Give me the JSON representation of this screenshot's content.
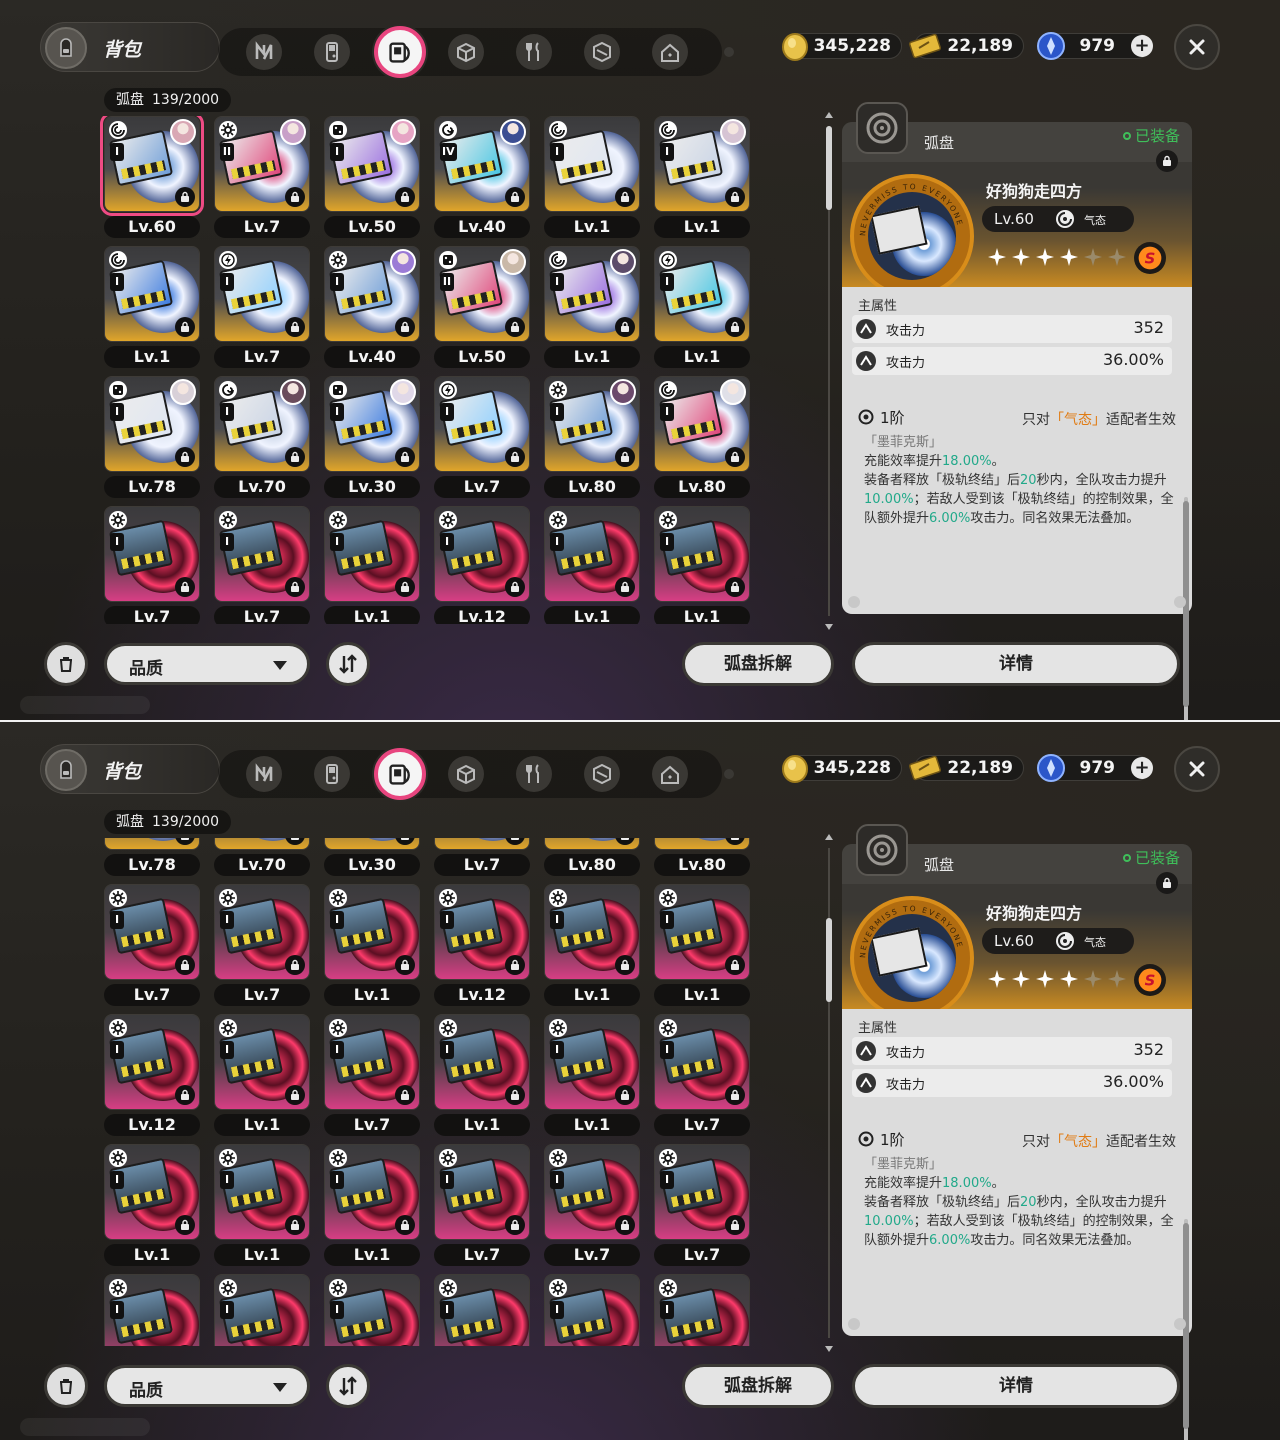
{
  "header": {
    "bag_title": "背包",
    "tabs": [
      "hollow-zero-icon",
      "console-icon",
      "w-engine-disc-icon",
      "box-icon",
      "food-icon",
      "bangboo-icon",
      "home-icon"
    ],
    "active_tab": 2,
    "currencies": [
      {
        "name": "dennies",
        "value": "345,228"
      },
      {
        "name": "film",
        "value": "22,189"
      },
      {
        "name": "polychrome",
        "value": "979"
      }
    ]
  },
  "inventory": {
    "category": "弧盘",
    "count": "139/2000"
  },
  "screens": [
    {
      "items": [
        {
          "lv": "Lv.60",
          "rank": "I",
          "attr": "swirl",
          "tint": "gold",
          "avatar": "#d9a7b4",
          "selected": true
        },
        {
          "lv": "Lv.7",
          "rank": "II",
          "attr": "gear",
          "tint": "gold",
          "avatar": "#c8a0c8"
        },
        {
          "lv": "Lv.50",
          "rank": "I",
          "attr": "dice",
          "tint": "gold",
          "avatar": "#e6a4c4"
        },
        {
          "lv": "Lv.40",
          "rank": "IV",
          "attr": "spiral",
          "tint": "gold",
          "avatar": "#3c4e92"
        },
        {
          "lv": "Lv.1",
          "rank": "I",
          "attr": "swirl",
          "tint": "gold",
          "avatar": ""
        },
        {
          "lv": "Lv.1",
          "rank": "I",
          "attr": "swirl",
          "tint": "gold",
          "avatar": "#d6c4d4"
        },
        {
          "lv": "Lv.1",
          "rank": "I",
          "attr": "swirl",
          "tint": "gold",
          "avatar": ""
        },
        {
          "lv": "Lv.7",
          "rank": "I",
          "attr": "bolt",
          "tint": "gold",
          "avatar": ""
        },
        {
          "lv": "Lv.40",
          "rank": "I",
          "attr": "gear",
          "tint": "gold",
          "avatar": "#9b7bd6"
        },
        {
          "lv": "Lv.50",
          "rank": "II",
          "attr": "dice",
          "tint": "gold",
          "avatar": "#c9b8a8"
        },
        {
          "lv": "Lv.1",
          "rank": "I",
          "attr": "swirl",
          "tint": "gold",
          "avatar": "#5c4c6a"
        },
        {
          "lv": "Lv.1",
          "rank": "I",
          "attr": "bolt",
          "tint": "gold",
          "avatar": ""
        },
        {
          "lv": "Lv.78",
          "rank": "I",
          "attr": "dice",
          "tint": "gold",
          "avatar": "#d8d0d8"
        },
        {
          "lv": "Lv.70",
          "rank": "I",
          "attr": "spiral",
          "tint": "gold",
          "avatar": "#6a4c5c"
        },
        {
          "lv": "Lv.30",
          "rank": "I",
          "attr": "dice",
          "tint": "gold",
          "avatar": "#e0d8e8"
        },
        {
          "lv": "Lv.7",
          "rank": "I",
          "attr": "bolt",
          "tint": "gold",
          "avatar": ""
        },
        {
          "lv": "Lv.80",
          "rank": "I",
          "attr": "gear",
          "tint": "gold",
          "avatar": "#6c4a6c"
        },
        {
          "lv": "Lv.80",
          "rank": "I",
          "attr": "swirl",
          "tint": "gold",
          "avatar": "#e0e0e8"
        },
        {
          "lv": "Lv.7",
          "rank": "I",
          "attr": "gear",
          "tint": "pink",
          "avatar": ""
        },
        {
          "lv": "Lv.7",
          "rank": "I",
          "attr": "gear",
          "tint": "pink",
          "avatar": ""
        },
        {
          "lv": "Lv.1",
          "rank": "I",
          "attr": "gear",
          "tint": "pink",
          "avatar": ""
        },
        {
          "lv": "Lv.12",
          "rank": "I",
          "attr": "gear",
          "tint": "pink",
          "avatar": ""
        },
        {
          "lv": "Lv.1",
          "rank": "I",
          "attr": "gear",
          "tint": "pink",
          "avatar": ""
        },
        {
          "lv": "Lv.1",
          "rank": "I",
          "attr": "gear",
          "tint": "pink",
          "avatar": ""
        }
      ]
    },
    {
      "items": [
        {
          "lv": "Lv.78",
          "rank": "",
          "attr": "",
          "tint": "gold",
          "avatar": ""
        },
        {
          "lv": "Lv.70",
          "rank": "",
          "attr": "",
          "tint": "gold",
          "avatar": ""
        },
        {
          "lv": "Lv.30",
          "rank": "",
          "attr": "",
          "tint": "gold",
          "avatar": ""
        },
        {
          "lv": "Lv.7",
          "rank": "",
          "attr": "",
          "tint": "gold",
          "avatar": ""
        },
        {
          "lv": "Lv.80",
          "rank": "",
          "attr": "",
          "tint": "gold",
          "avatar": ""
        },
        {
          "lv": "Lv.80",
          "rank": "",
          "attr": "",
          "tint": "gold",
          "avatar": ""
        },
        {
          "lv": "Lv.7",
          "rank": "I",
          "attr": "gear",
          "tint": "pink",
          "avatar": ""
        },
        {
          "lv": "Lv.7",
          "rank": "I",
          "attr": "gear",
          "tint": "pink",
          "avatar": ""
        },
        {
          "lv": "Lv.1",
          "rank": "I",
          "attr": "gear",
          "tint": "pink",
          "avatar": ""
        },
        {
          "lv": "Lv.12",
          "rank": "I",
          "attr": "gear",
          "tint": "pink",
          "avatar": ""
        },
        {
          "lv": "Lv.1",
          "rank": "I",
          "attr": "gear",
          "tint": "pink",
          "avatar": ""
        },
        {
          "lv": "Lv.1",
          "rank": "I",
          "attr": "gear",
          "tint": "pink",
          "avatar": ""
        },
        {
          "lv": "Lv.12",
          "rank": "I",
          "attr": "gear",
          "tint": "pink",
          "avatar": ""
        },
        {
          "lv": "Lv.1",
          "rank": "I",
          "attr": "gear",
          "tint": "pink",
          "avatar": ""
        },
        {
          "lv": "Lv.7",
          "rank": "I",
          "attr": "gear",
          "tint": "pink",
          "avatar": ""
        },
        {
          "lv": "Lv.1",
          "rank": "I",
          "attr": "gear",
          "tint": "pink",
          "avatar": ""
        },
        {
          "lv": "Lv.1",
          "rank": "I",
          "attr": "gear",
          "tint": "pink",
          "avatar": ""
        },
        {
          "lv": "Lv.7",
          "rank": "I",
          "attr": "gear",
          "tint": "pink",
          "avatar": ""
        },
        {
          "lv": "Lv.1",
          "rank": "I",
          "attr": "gear",
          "tint": "pink",
          "avatar": ""
        },
        {
          "lv": "Lv.1",
          "rank": "I",
          "attr": "gear",
          "tint": "pink",
          "avatar": ""
        },
        {
          "lv": "Lv.1",
          "rank": "I",
          "attr": "gear",
          "tint": "pink",
          "avatar": ""
        },
        {
          "lv": "Lv.7",
          "rank": "I",
          "attr": "gear",
          "tint": "pink",
          "avatar": ""
        },
        {
          "lv": "Lv.7",
          "rank": "I",
          "attr": "gear",
          "tint": "pink",
          "avatar": ""
        },
        {
          "lv": "Lv.7",
          "rank": "I",
          "attr": "gear",
          "tint": "pink",
          "avatar": ""
        },
        {
          "lv": "",
          "rank": "I",
          "attr": "gear",
          "tint": "pink",
          "avatar": ""
        },
        {
          "lv": "",
          "rank": "I",
          "attr": "gear",
          "tint": "pink",
          "avatar": ""
        },
        {
          "lv": "",
          "rank": "I",
          "attr": "gear",
          "tint": "pink",
          "avatar": ""
        },
        {
          "lv": "",
          "rank": "I",
          "attr": "gear",
          "tint": "pink",
          "avatar": ""
        },
        {
          "lv": "",
          "rank": "I",
          "attr": "gear",
          "tint": "pink",
          "avatar": ""
        },
        {
          "lv": "",
          "rank": "I",
          "attr": "gear",
          "tint": "pink",
          "avatar": ""
        }
      ]
    }
  ],
  "detail": {
    "type": "弧盘",
    "equipped": "已装备",
    "name": "好狗狗走四方",
    "level": "Lv.60",
    "specialty": "气态",
    "ring_text": "NEVERMISS TO EVERYONE",
    "stars_filled": 4,
    "stars_total": 6,
    "rank": "S",
    "main_stats_title": "主属性",
    "stats": [
      {
        "name": "攻击力",
        "value": "352"
      },
      {
        "name": "攻击力",
        "value": "36.00%"
      }
    ],
    "tier": "1阶",
    "condition_pre": "只对",
    "condition_hl": "「气态」",
    "condition_post": "适配者生效",
    "effect_name": "「墨菲克斯」",
    "effect_l1a": "充能效率提升",
    "effect_l1b": "18.00%",
    "effect_l1c": "。",
    "effect_l2a": "装备者释放「极轨终结」后",
    "effect_l2b": "20",
    "effect_l2c": "秒内，全队攻击力提升",
    "effect_l2d": "10.00%",
    "effect_l2e": "；若敌人受到该「极轨终结」的控制效果，全队额外提升",
    "effect_l2f": "6.00%",
    "effect_l2g": "攻击力。同名效果无法叠加。"
  },
  "footer": {
    "sort_label": "品质",
    "dismantle_label": "弧盘拆解",
    "details_label": "详情"
  },
  "colors": {
    "accent_pink": "#ee4b84",
    "gold_tint": "#e0a020",
    "pink_tint": "#d0306a",
    "equipped_green": "#3fbf5a",
    "highlight_orange": "#e07b13",
    "value_teal": "#22a98a"
  }
}
